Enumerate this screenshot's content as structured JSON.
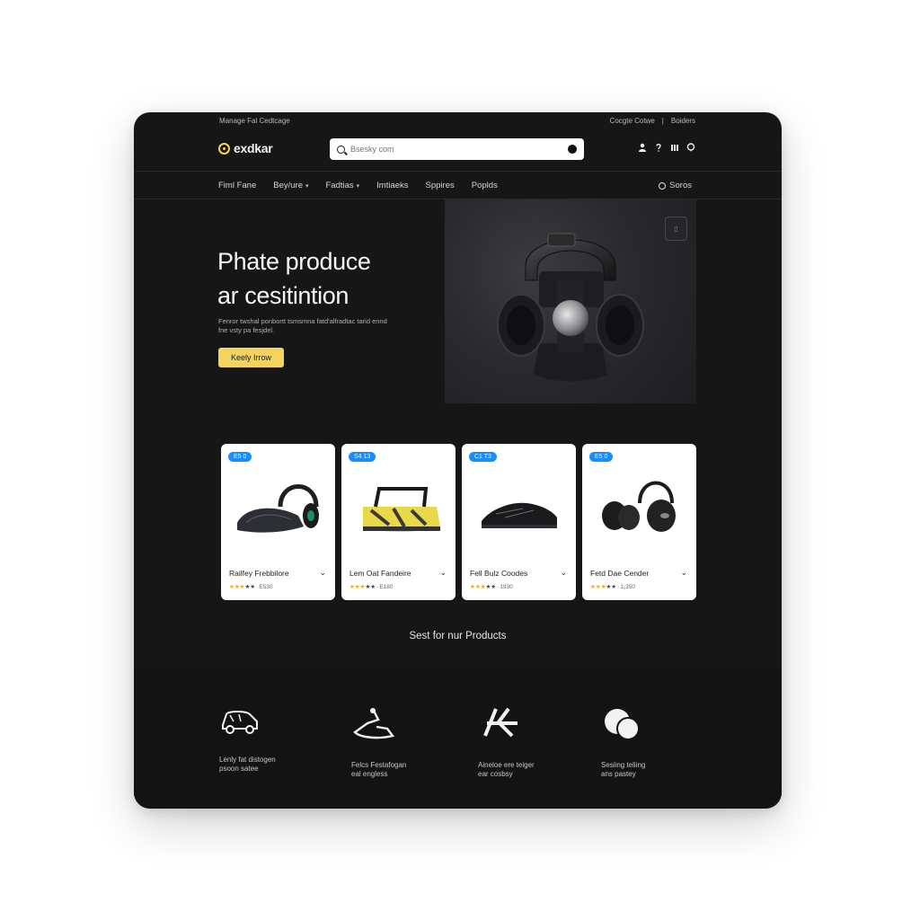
{
  "topbar": {
    "left_text": "Manage Fal Cedtcage",
    "right_links": [
      "Cocgte Cotwe",
      "|",
      "Boiders"
    ]
  },
  "header": {
    "logo_text": "exdkar",
    "search_placeholder": "Bsesky com"
  },
  "nav": {
    "items": [
      {
        "label": "Fiml Fane",
        "dropdown": false
      },
      {
        "label": "Bey/ure",
        "dropdown": true
      },
      {
        "label": "Fadtias",
        "dropdown": true
      },
      {
        "label": "Imtiaeks",
        "dropdown": false
      },
      {
        "label": "Sppires",
        "dropdown": false
      },
      {
        "label": "Poplds",
        "dropdown": false
      }
    ],
    "right_label": "Soros"
  },
  "hero": {
    "title_line1": "Phate produce",
    "title_line2": "ar cesitintion",
    "subtitle": "Fenror twshal ponbortt tsmsmna fatd'alfradtac tarid ennd fne vsty pa fesjdel.",
    "cta_label": "Keely Irrow"
  },
  "products": [
    {
      "tag": "E5 0",
      "name": "Railfey Frebbilore",
      "rating_text": "E530"
    },
    {
      "tag": "S4 13",
      "name": "Lem Oat Fandeire",
      "rating_text": "E180"
    },
    {
      "tag": "C1 T3",
      "name": "Fell Bulz Coodes",
      "rating_text": "1930"
    },
    {
      "tag": "E5 0",
      "name": "Fetd Dae Cender",
      "rating_text": "1¡350"
    }
  ],
  "section_title": "Sest for nur Products",
  "features": [
    {
      "icon": "car-icon",
      "line1": "Lenly fat distogen",
      "line2": "psoon satee"
    },
    {
      "icon": "device-icon",
      "line1": "Felcs Festafogan",
      "line2": "eal engless"
    },
    {
      "icon": "brand-mark-icon",
      "line1": "Aineloe ere teiger",
      "line2": "ear cosbsy"
    },
    {
      "icon": "circles-icon",
      "line1": "Sesiing teliing",
      "line2": "ans pastey"
    }
  ],
  "colors": {
    "accent": "#f4d35e",
    "tag_blue": "#1a8cff",
    "background": "#161617"
  }
}
